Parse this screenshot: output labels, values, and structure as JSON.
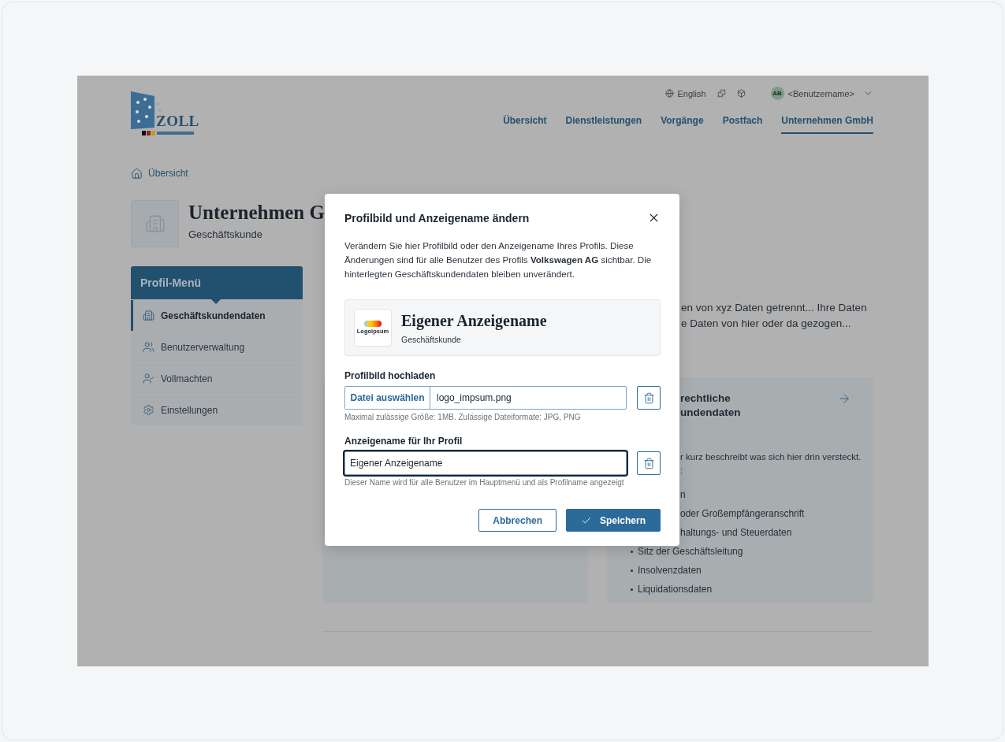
{
  "header": {
    "logo_text": "ZOLL",
    "language": "English",
    "user": {
      "initials": "AB",
      "name": "<Benutzername>"
    },
    "nav": [
      {
        "label": "Übersicht",
        "selected": false
      },
      {
        "label": "Dienstleistungen",
        "selected": false
      },
      {
        "label": "Vorgänge",
        "selected": false
      },
      {
        "label": "Postfach",
        "selected": false
      },
      {
        "label": "Unternehmen GmbH",
        "selected": true
      }
    ]
  },
  "breadcrumb": "Übersicht",
  "profile": {
    "title": "Unternehmen G",
    "subtitle": "Geschäftskunde"
  },
  "profile_menu": {
    "title": "Profil-Menü",
    "items": [
      {
        "kind": "building",
        "label": "Geschäftskundendaten",
        "selected": true
      },
      {
        "kind": "users",
        "label": "Benutzerverwaltung",
        "selected": false
      },
      {
        "kind": "user-check",
        "label": "Vollmachten",
        "selected": false
      },
      {
        "kind": "gear",
        "label": "Einstellungen",
        "selected": false
      }
    ]
  },
  "intro_fragments": [
    "en von xyz Daten getrennt... Ihre Daten",
    "e Daten von hier oder da gezogen..."
  ],
  "data_card": {
    "title_lines": [
      "rechtliche",
      "undendaten"
    ],
    "lines": [
      {
        "kind": "para",
        "text": "r kurz beschreibt was sich hier drin versteckt."
      },
      {
        "kind": "para",
        "text": ":"
      },
      {
        "kind": "fragment",
        "text": "n"
      },
      {
        "kind": "fragment",
        "text": "oder Großempfängeranschrift"
      },
      {
        "kind": "fragment",
        "text": "haltungs- und Steuerdaten"
      },
      {
        "kind": "bullet",
        "text": "Sitz der Geschäftsleitung"
      },
      {
        "kind": "bullet",
        "text": "Insolvenzdaten"
      },
      {
        "kind": "bullet",
        "text": "Liquidationsdaten"
      }
    ]
  },
  "dialog": {
    "title": "Profilbild und Anzeigename ändern",
    "description": "Verändern Sie hier Profilbild oder den Anzeigename Ihres Profils. Diese Änderungen sind für alle Benutzer des Profils **Volkswagen AG** sichtbar. Die hinterlegten Geschäftskundendaten bleiben unverändert.",
    "preview": {
      "logo_text": "Logoipsum",
      "name": "Eigener Anzeigename",
      "subtitle": "Geschäftskunde"
    },
    "upload": {
      "label": "Profilbild hochladen",
      "button": "Datei auswählen",
      "file_name": "logo_impsum.png",
      "hint": "Maximal zulässige Größe: 1MB. Zulässige Dateiformate: JPG, PNG"
    },
    "display_name": {
      "label": "Anzeigename für Ihr Profil",
      "value": "Eigener Anzeigename",
      "focused": true,
      "hint": "Dieser Name wird für alle Benutzer im Hauptmenü und als Profilname angezeigt"
    },
    "buttons": [
      {
        "kind": "secondary",
        "label": "Abbrechen"
      },
      {
        "kind": "primary",
        "label": "Speichern"
      }
    ]
  }
}
